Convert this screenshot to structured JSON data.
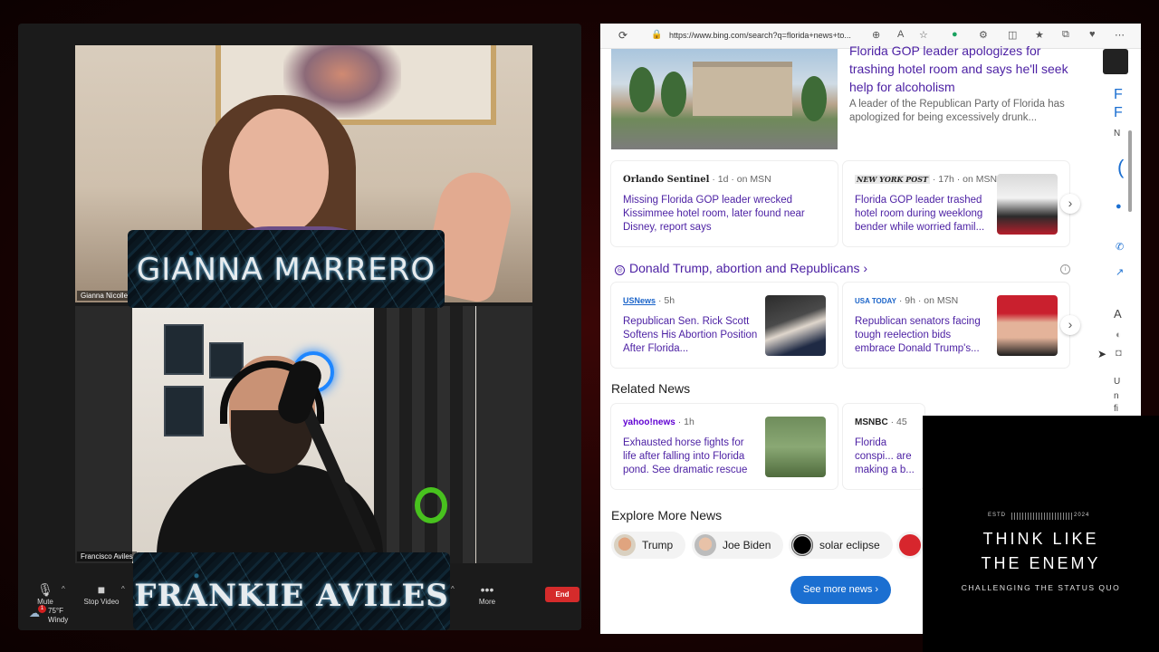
{
  "zoom": {
    "participants": [
      {
        "name": "Gianna Nicolle",
        "overlay": "GIANNA MARRERO"
      },
      {
        "name": "Francisco Aviles",
        "overlay": "FRANKIE AVILES"
      }
    ],
    "toolbar": {
      "mute_label": "Mute",
      "stop_video_label": "Stop Video",
      "more_label": "More",
      "end_label": "End"
    }
  },
  "weather": {
    "temp": "75°F",
    "condition": "Windy",
    "badge": "1"
  },
  "browser": {
    "url": "https://www.bing.com/search?q=florida+news+to...",
    "hero": {
      "title": "Florida GOP leader apologizes for trashing hotel room and says he'll seek help for alcoholism",
      "description": "A leader of the Republican Party of Florida has apologized for being excessively drunk..."
    },
    "row1": [
      {
        "source": "Orlando Sentinel",
        "meta": "· 1d · on MSN",
        "title": "Missing Florida GOP leader wrecked Kissimmee hotel room, later found near Disney, report says"
      },
      {
        "source": "NEW YORK POST",
        "meta": "· 17h · on MSN",
        "title": "Florida GOP leader trashed hotel room during weeklong bender while worried famil..."
      }
    ],
    "topic": {
      "title": "Donald Trump, abortion and Republicans ›",
      "info": "i"
    },
    "row2": [
      {
        "source": "USNews",
        "meta": "· 5h",
        "title": "Republican Sen. Rick Scott Softens His Abortion Position After Florida..."
      },
      {
        "source": "USA TODAY",
        "meta": "· 9h · on MSN",
        "title": "Republican senators facing tough reelection bids embrace Donald Trump's..."
      }
    ],
    "related_news_label": "Related News",
    "row3": [
      {
        "source": "yahoo!news",
        "meta": "· 1h",
        "title": "Exhausted horse fights for life after falling into Florida pond. See dramatic rescue"
      },
      {
        "source": "MSNBC",
        "meta": "· 45",
        "title": "Florida conspi... are making a b... commandeer a..."
      }
    ],
    "explore_label": "Explore More News",
    "chips": [
      "Trump",
      "Joe Biden",
      "solar eclipse"
    ],
    "see_more_label": "See more news ›",
    "side_letters": [
      "F",
      "F",
      "N",
      "A",
      "U",
      "n",
      "fi"
    ]
  },
  "logo": {
    "estd": "ESTD",
    "year": "2024",
    "title_line1": "THINK LIKE",
    "title_line2": "THE ENEMY",
    "subtitle": "CHALLENGING THE STATUS QUO"
  }
}
